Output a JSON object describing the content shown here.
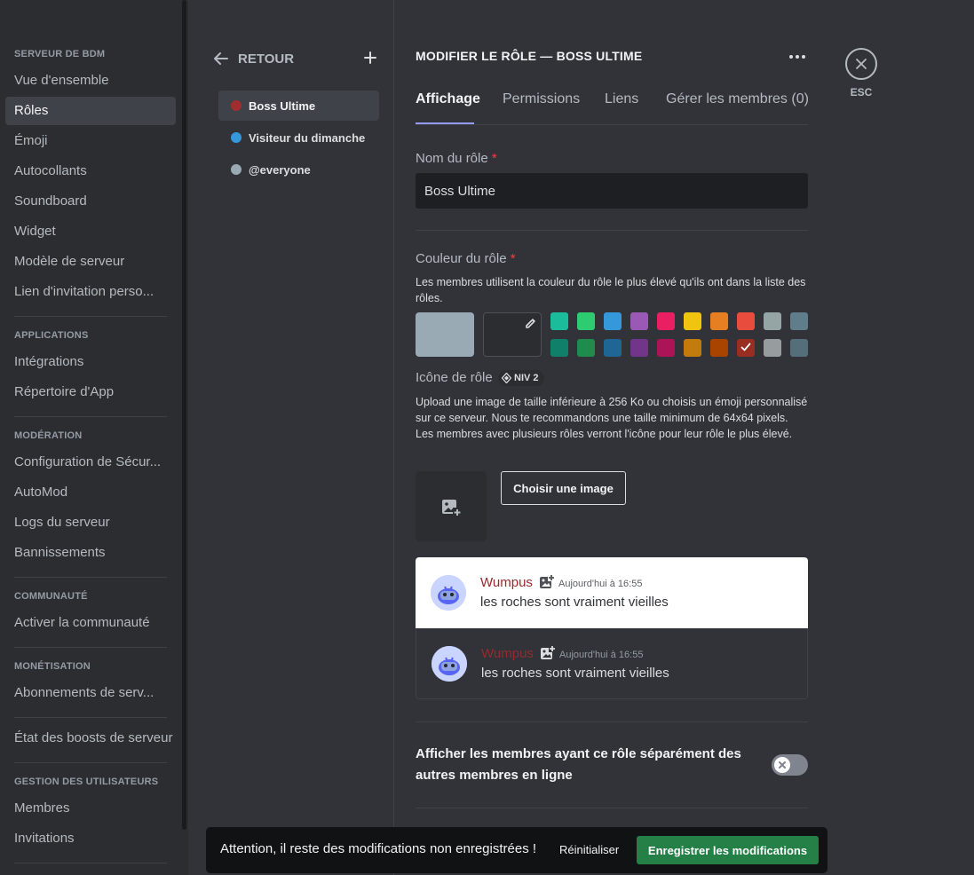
{
  "sidebar": {
    "sections": [
      {
        "header": "SERVEUR DE BDM",
        "items": [
          "Vue d'ensemble",
          "Rôles",
          "Émoji",
          "Autocollants",
          "Soundboard",
          "Widget",
          "Modèle de serveur",
          "Lien d'invitation perso..."
        ]
      },
      {
        "header": "APPLICATIONS",
        "items": [
          "Intégrations",
          "Répertoire d'App"
        ]
      },
      {
        "header": "MODÉRATION",
        "items": [
          "Configuration de Sécur...",
          "AutoMod",
          "Logs du serveur",
          "Bannissements"
        ]
      },
      {
        "header": "COMMUNAUTÉ",
        "items": [
          "Activer la communauté"
        ]
      },
      {
        "header": "MONÉTISATION",
        "items": [
          "Abonnements de serv..."
        ]
      },
      {
        "header": "",
        "items": [
          "État des boosts de serveur"
        ]
      },
      {
        "header": "GESTION DES UTILISATEURS",
        "items": [
          "Membres",
          "Invitations"
        ]
      }
    ],
    "active_item": "Rôles"
  },
  "roles_panel": {
    "back_label": "RETOUR",
    "add_icon": "plus-icon",
    "roles": [
      {
        "name": "Boss Ultime",
        "color": "#a12d2f",
        "active": true
      },
      {
        "name": "Visiteur du dimanche",
        "color": "#3498db",
        "active": false
      },
      {
        "name": "@everyone",
        "color": "#99aab5",
        "active": false
      }
    ]
  },
  "editor": {
    "title": "MODIFIER LE RÔLE — BOSS ULTIME",
    "tabs": [
      "Affichage",
      "Permissions",
      "Liens",
      "Gérer les membres (0)"
    ],
    "active_tab": "Affichage",
    "name_label": "Nom du rôle",
    "required_mark": "*",
    "name_value": "Boss Ultime",
    "color_label": "Couleur du rôle",
    "color_desc": "Les membres utilisent la couleur du rôle le plus élevé qu'ils ont dans la liste des rôles.",
    "default_color": "#99aab5",
    "swatches_row1": [
      "#1abc9c",
      "#2ecc71",
      "#3498db",
      "#9b59b6",
      "#e91e63",
      "#f1c40f",
      "#e67e22",
      "#e74c3c",
      "#95a5a6",
      "#607d8b"
    ],
    "swatches_row2": [
      "#11806a",
      "#1f8b4c",
      "#206694",
      "#71368a",
      "#ad1457",
      "#c27c0e",
      "#a84300",
      "#992d22",
      "#979c9f",
      "#546e7a"
    ],
    "selected_swatch_index": 7,
    "icon_label": "Icône de rôle",
    "icon_badge": "NIV 2",
    "icon_desc": "Upload une image de taille inférieure à 256 Ko ou choisis un émoji personnalisé sur ce serveur. Nous te recommandons une taille minimum de 64x64 pixels. Les membres avec plusieurs rôles verront l'icône pour leur rôle le plus élevé.",
    "choose_image_label": "Choisir une image",
    "preview": {
      "username": "Wumpus",
      "timestamp": "Aujourd'hui à 16:55",
      "message": "les roches sont vraiment vieilles"
    },
    "hoist_label": "Afficher les membres ayant ce rôle séparément des autres membres en ligne",
    "hoist_enabled": false
  },
  "close": {
    "label": "ESC",
    "icon": "close-icon"
  },
  "notice": {
    "text": "Attention, il reste des modifications non enregistrées !",
    "reset_label": "Réinitialiser",
    "save_label": "Enregistrer les modifications"
  }
}
